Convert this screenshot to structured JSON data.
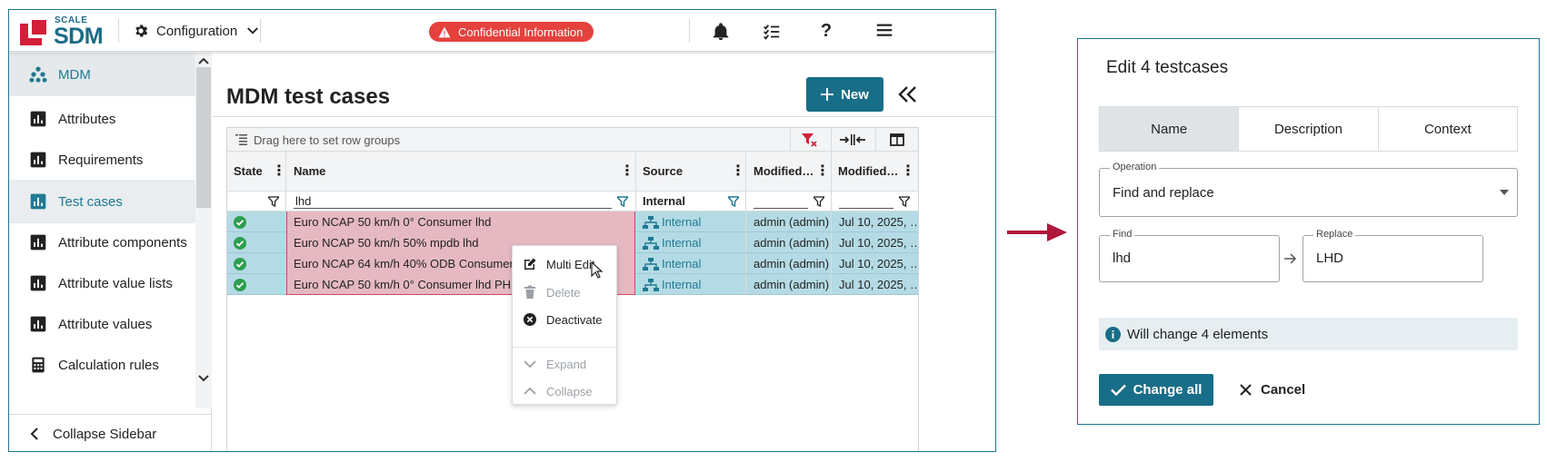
{
  "app": {
    "logo": {
      "scale": "SCALE",
      "sdm": "SDM"
    },
    "module_selector": {
      "label": "Configuration",
      "icon": "gear-icon"
    },
    "badge": {
      "label": "Confidential Information",
      "icon": "warning-icon"
    },
    "toolbar_icons": [
      "bell-icon",
      "checklist-icon",
      "help-icon",
      "menu-icon"
    ],
    "help_glyph": "?"
  },
  "sidebar": {
    "items": [
      {
        "label": "MDM",
        "icon": "hierarchy-icon"
      },
      {
        "label": "Attributes",
        "icon": "chart-icon"
      },
      {
        "label": "Requirements",
        "icon": "chart-icon"
      },
      {
        "label": "Test cases",
        "icon": "chart-icon"
      },
      {
        "label": "Attribute components",
        "icon": "chart-icon"
      },
      {
        "label": "Attribute value lists",
        "icon": "chart-icon"
      },
      {
        "label": "Attribute values",
        "icon": "chart-icon"
      },
      {
        "label": "Calculation rules",
        "icon": "calculator-icon"
      }
    ],
    "collapse_label": "Collapse Sidebar"
  },
  "main": {
    "title": "MDM test cases",
    "new_button": "New"
  },
  "grid": {
    "group_hint": "Drag here to set row groups",
    "columns": [
      "State",
      "Name",
      "Source",
      "Modified…",
      "Modified…"
    ],
    "filters": {
      "name": "lhd",
      "source": "Internal"
    },
    "rows": [
      {
        "name": "Euro NCAP 50 km/h 0° Consumer lhd",
        "source": "Internal",
        "modified_by": "admin (admin)",
        "modified_on": "Jul 10, 2025, …"
      },
      {
        "name": "Euro NCAP 50 km/h 50% mpdb lhd",
        "source": "Internal",
        "modified_by": "admin (admin)",
        "modified_on": "Jul 10, 2025, …"
      },
      {
        "name": "Euro NCAP 64 km/h 40% ODB Consumer lhd",
        "source": "Internal",
        "modified_by": "admin (admin)",
        "modified_on": "Jul 10, 2025, …"
      },
      {
        "name": "Euro NCAP 50 km/h 0° Consumer lhd PHEV",
        "source": "Internal",
        "modified_by": "admin (admin)",
        "modified_on": "Jul 10, 2025, …"
      }
    ]
  },
  "context_menu": {
    "items": [
      {
        "label": "Multi Edit",
        "icon": "edit-icon",
        "enabled": true
      },
      {
        "label": "Delete",
        "icon": "trash-icon",
        "enabled": false
      },
      {
        "label": "Deactivate",
        "icon": "close-circle-icon",
        "enabled": true
      },
      {
        "label": "Expand",
        "icon": "chevron-down-icon",
        "enabled": false
      },
      {
        "label": "Collapse",
        "icon": "chevron-up-icon",
        "enabled": false
      }
    ]
  },
  "dialog": {
    "title": "Edit 4 testcases",
    "tabs": [
      "Name",
      "Description",
      "Context"
    ],
    "operation": {
      "label": "Operation",
      "value": "Find and replace"
    },
    "find": {
      "label": "Find",
      "value": "lhd"
    },
    "replace": {
      "label": "Replace",
      "value": "LHD"
    },
    "info": "Will change 4 elements",
    "change_button": "Change all",
    "cancel_button": "Cancel"
  },
  "colors": {
    "accent": "#186e88",
    "brand_red": "#d31f3a",
    "alert": "#e5413d",
    "arrow": "#b0173a",
    "row_selected": "#b4dbe5",
    "name_highlight": "#e6b9c2"
  }
}
